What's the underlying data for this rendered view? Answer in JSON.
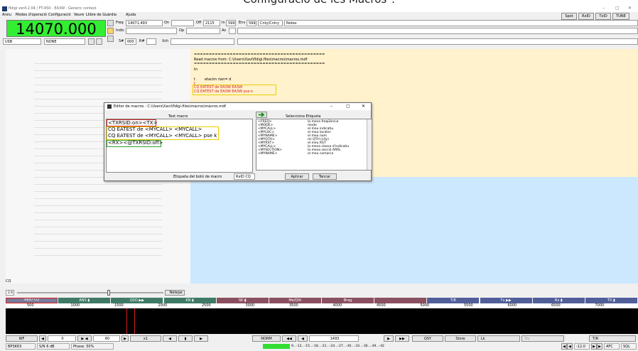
{
  "caption": "Configuració de les Macros\".",
  "window": {
    "title": "fldigi ver4.2.04 / FT-450 - EA3W : Generic contest",
    "controls": [
      "–",
      "▢",
      "✕"
    ]
  },
  "menu": [
    "Arxiu",
    "Modes d'operació",
    "Configuració",
    "Veure",
    "Llibre de Guàrdia",
    "Ajuda"
  ],
  "top_buttons": [
    "Spot",
    "RxID",
    "TxID",
    "TUNE"
  ],
  "frequency": "14070.000",
  "log": {
    "freq_label": "Freq",
    "freq_value": "14071.493",
    "on_label": "On",
    "off_label": "Off",
    "off_value": "2115",
    "in_label": "In",
    "in_value": "599",
    "out_label": "Env",
    "out_value": "599",
    "cnty_label": "Cnty/Cntry",
    "notes_label": "Notes",
    "call_label": "Indic",
    "op_label": "Op",
    "az_label": "Az",
    "st_label": "S#",
    "st_value": "000",
    "rx_label": "R#",
    "xch_label": "Xch"
  },
  "mode": {
    "value": "USB",
    "submode": "NONE"
  },
  "rx_text": {
    "separator": "============================================",
    "read_macros": "Read macros from: C:\\Users\\Xavi\\fldigi.files\\macros\\macros.mdf",
    "line_tn": "tn",
    "line_t": "t",
    "line_etacm": "etacim rian=      d",
    "line_t2": "t",
    "cq1": "CQ EATEST de EA3W EA3W",
    "cq2": "CQ EATEST de EA3W EA3W pse k"
  },
  "dialog": {
    "title": "Editor de macros - C:\\Users\\Xavi\\fldigi.files\\macros\\macros.mdf",
    "text_macro_label": "Text macro",
    "select_tag_label": "Selecciona Etiqueta",
    "macro_lines": [
      "<TXRSID:on><TX>",
      "CQ EATEST de <MYCALL> <MYCALL>",
      "CQ EATEST de <MYCALL> <MYCALL> pse k",
      "<RX><@TXRSID:off>"
    ],
    "tags": [
      {
        "tag": "<FREQ>",
        "desc": "la meva freqüència"
      },
      {
        "tag": "<MODE>",
        "desc": "mode"
      },
      {
        "tag": "<MYCALL>",
        "desc": "el meu indicatiu"
      },
      {
        "tag": "<MYLOC>",
        "desc": "el meu locator"
      },
      {
        "tag": "<MYNAME>",
        "desc": "el meu nom"
      },
      {
        "tag": "<MYQTH>",
        "desc": "mi QTH (city)"
      },
      {
        "tag": "<MYRST>",
        "desc": "el meu RST"
      },
      {
        "tag": "<MYCALL>",
        "desc": "la meva classe d'indicatiu"
      },
      {
        "tag": "<MYSECTION>",
        "desc": "la meva secció ARRL"
      },
      {
        "tag": "<MYNAME>",
        "desc": "el meu comarca"
      }
    ],
    "button_label_caption": "Etiqueta del botó de macro",
    "button_label_value": "RxID CQ",
    "apply": "Aplicar",
    "close": "Tancar"
  },
  "cq_label": "CQ",
  "squelch": {
    "value": "2.6",
    "button": "Netejar"
  },
  "macros": [
    {
      "label": "RxID CQ",
      "color": "#7a7a9a"
    },
    {
      "label": "ANS ▮",
      "color": "#3f7a66"
    },
    {
      "label": "QSO ▶▶",
      "color": "#3f7a66"
    },
    {
      "label": "KN ▮",
      "color": "#3f7a66"
    },
    {
      "label": "SK ▮",
      "color": "#8a5060"
    },
    {
      "label": "Me/Qth",
      "color": "#8a5060"
    },
    {
      "label": "Brag",
      "color": "#8a5060"
    },
    {
      "label": "",
      "color": "#8a5060"
    },
    {
      "label": "T/R",
      "color": "#505e9a"
    },
    {
      "label": "Tx ▶▶",
      "color": "#505e9a"
    },
    {
      "label": "Rx ▮",
      "color": "#505e9a"
    },
    {
      "label": "TX ▮",
      "color": "#505e9a"
    }
  ],
  "scale_ticks": [
    "500",
    "1000",
    "1500",
    "2000",
    "2500",
    "3000",
    "3500",
    "4000",
    "4500",
    "5000",
    "5500",
    "6000",
    "6500",
    "7000"
  ],
  "bottom": {
    "wf": "WF",
    "val1": "0",
    "val2": "60",
    "x1": "x1",
    "norm": "NORM",
    "freq": "1493",
    "qsy": "QSY",
    "store": "Store",
    "lk": "Lk",
    "rv": "Rv",
    "tr": "T/R"
  },
  "status": {
    "mode": "BPSK63",
    "sn": "S/N  6 dB",
    "phase": "Phase: 50%",
    "imd": "9...-12...-15...-18...-21...-24...-27...-30...-33...-36...-39...-42",
    "level": "-12.0",
    "afc": "AFC",
    "sql": "SQL"
  }
}
